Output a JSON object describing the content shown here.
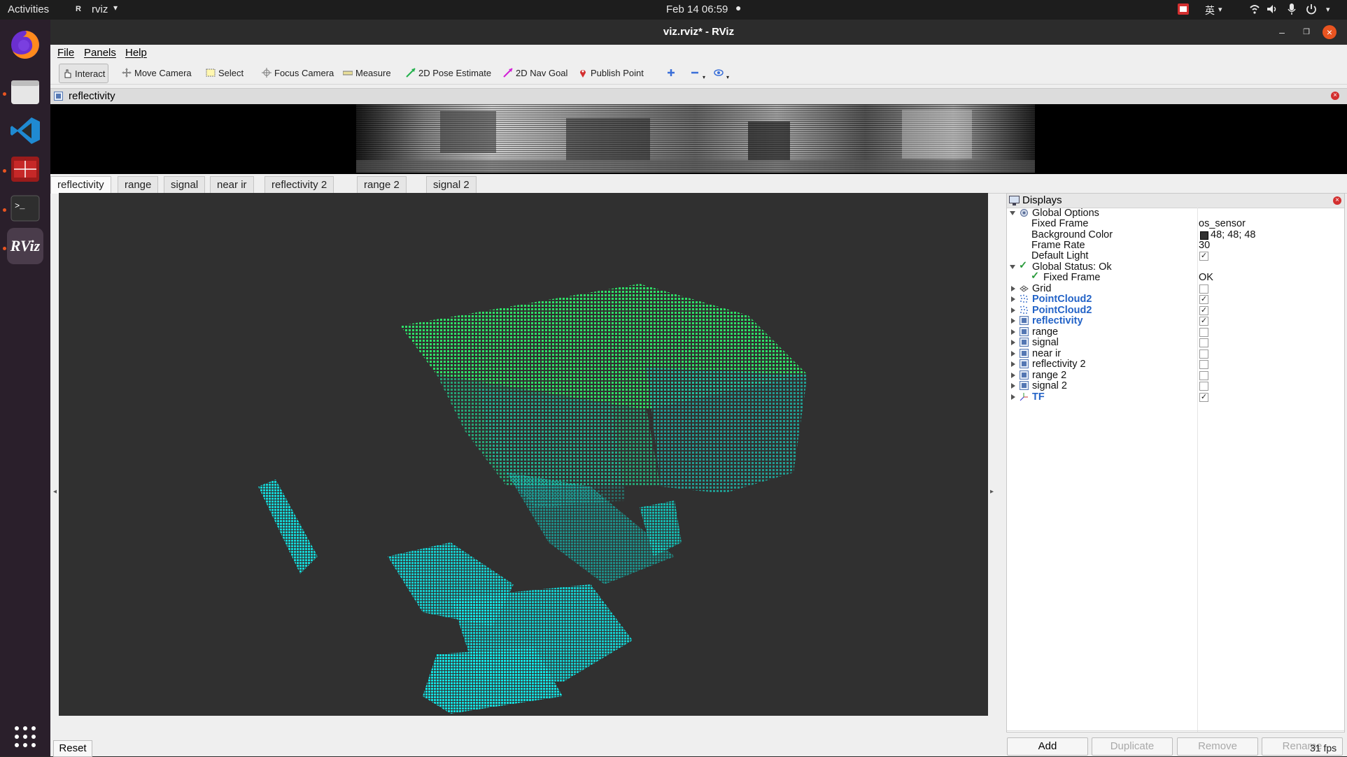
{
  "topbar": {
    "activities": "Activities",
    "app_name": "rviz",
    "clock": "Feb 14  06:59",
    "input_method": "英"
  },
  "dock": {
    "apps": [
      "firefox-icon",
      "files-icon",
      "vscode-icon",
      "terminal-red-icon",
      "terminal-icon",
      "rviz-icon"
    ],
    "rviz_label": "RViz"
  },
  "window": {
    "title": "viz.rviz* - RViz"
  },
  "menu": {
    "file": "File",
    "panels": "Panels",
    "help": "Help"
  },
  "toolbar": {
    "interact": "Interact",
    "move_camera": "Move Camera",
    "select": "Select",
    "focus_camera": "Focus Camera",
    "measure": "Measure",
    "pose_estimate": "2D Pose Estimate",
    "nav_goal": "2D Nav Goal",
    "publish_point": "Publish Point"
  },
  "image_panel": {
    "title": "reflectivity"
  },
  "tabs": [
    "reflectivity",
    "range",
    "signal",
    "near ir",
    "reflectivity 2",
    "range 2",
    "signal 2"
  ],
  "displays": {
    "title": "Displays",
    "global_options": "Global Options",
    "fixed_frame_label": "Fixed Frame",
    "fixed_frame_value": "os_sensor",
    "background_color_label": "Background Color",
    "background_color_value": "48; 48; 48",
    "frame_rate_label": "Frame Rate",
    "frame_rate_value": "30",
    "default_light_label": "Default Light",
    "global_status": "Global Status: Ok",
    "status_fixed_frame": "Fixed Frame",
    "status_fixed_frame_value": "OK",
    "items": [
      {
        "label": "Grid",
        "checked": false,
        "highlight": false
      },
      {
        "label": "PointCloud2",
        "checked": true,
        "highlight": true
      },
      {
        "label": "PointCloud2",
        "checked": true,
        "highlight": true
      },
      {
        "label": "reflectivity",
        "checked": true,
        "highlight": true
      },
      {
        "label": "range",
        "checked": false,
        "highlight": false
      },
      {
        "label": "signal",
        "checked": false,
        "highlight": false
      },
      {
        "label": "near ir",
        "checked": false,
        "highlight": false
      },
      {
        "label": "reflectivity 2",
        "checked": false,
        "highlight": false
      },
      {
        "label": "range 2",
        "checked": false,
        "highlight": false
      },
      {
        "label": "signal 2",
        "checked": false,
        "highlight": false
      },
      {
        "label": "TF",
        "checked": true,
        "highlight": true
      }
    ],
    "buttons": {
      "add": "Add",
      "duplicate": "Duplicate",
      "remove": "Remove",
      "rename": "Rename"
    }
  },
  "footer": {
    "reset": "Reset",
    "fps": "31 fps"
  },
  "colors": {
    "view_background": "#303030",
    "highlight_text": "#2363c7",
    "point_green": "#2ee86a",
    "point_cyan": "#12e6e6"
  }
}
